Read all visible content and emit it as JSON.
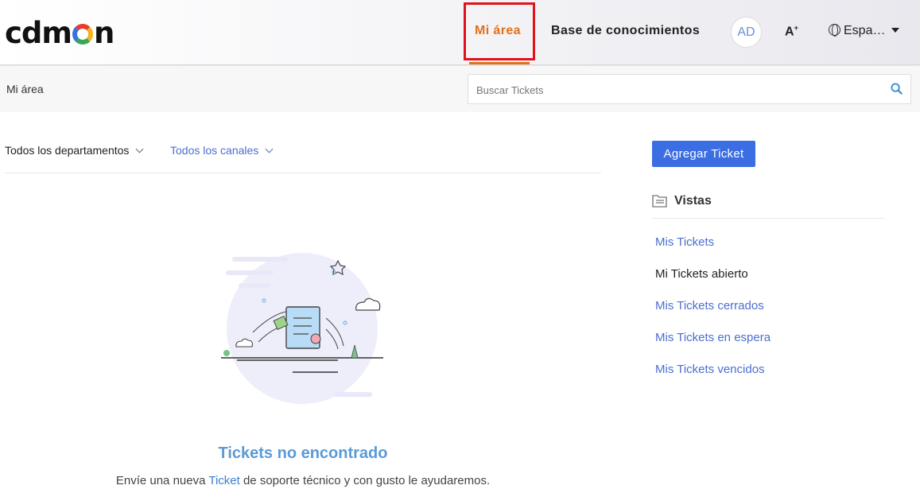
{
  "header": {
    "logo": "cdmon",
    "nav": {
      "mi_area": "Mi área",
      "knowledge_base": "Base de conocimientos"
    },
    "avatar_initials": "AD",
    "font_size_icon": "A",
    "language": "Espa…"
  },
  "subbar": {
    "breadcrumb": "Mi área",
    "search_placeholder": "Buscar Tickets"
  },
  "filters": {
    "department": "Todos los departamentos",
    "channel": "Todos los canales"
  },
  "empty_state": {
    "title": "Tickets no encontrado",
    "text_before": "Envíe una nueva",
    "link": "Ticket",
    "text_after": "de soporte técnico y con gusto le ayudaremos."
  },
  "sidebar": {
    "add_button": "Agregar Ticket",
    "views_title": "Vistas",
    "views": [
      {
        "label": "Mis Tickets"
      },
      {
        "label": "Mi Tickets abierto"
      },
      {
        "label": "Mis Tickets cerrados"
      },
      {
        "label": "Mis Tickets en espera"
      },
      {
        "label": "Mis Tickets vencidos"
      }
    ]
  },
  "colors": {
    "accent": "#3a6ee2",
    "active_nav": "#e36f1b",
    "highlight_box": "#e0121b"
  }
}
